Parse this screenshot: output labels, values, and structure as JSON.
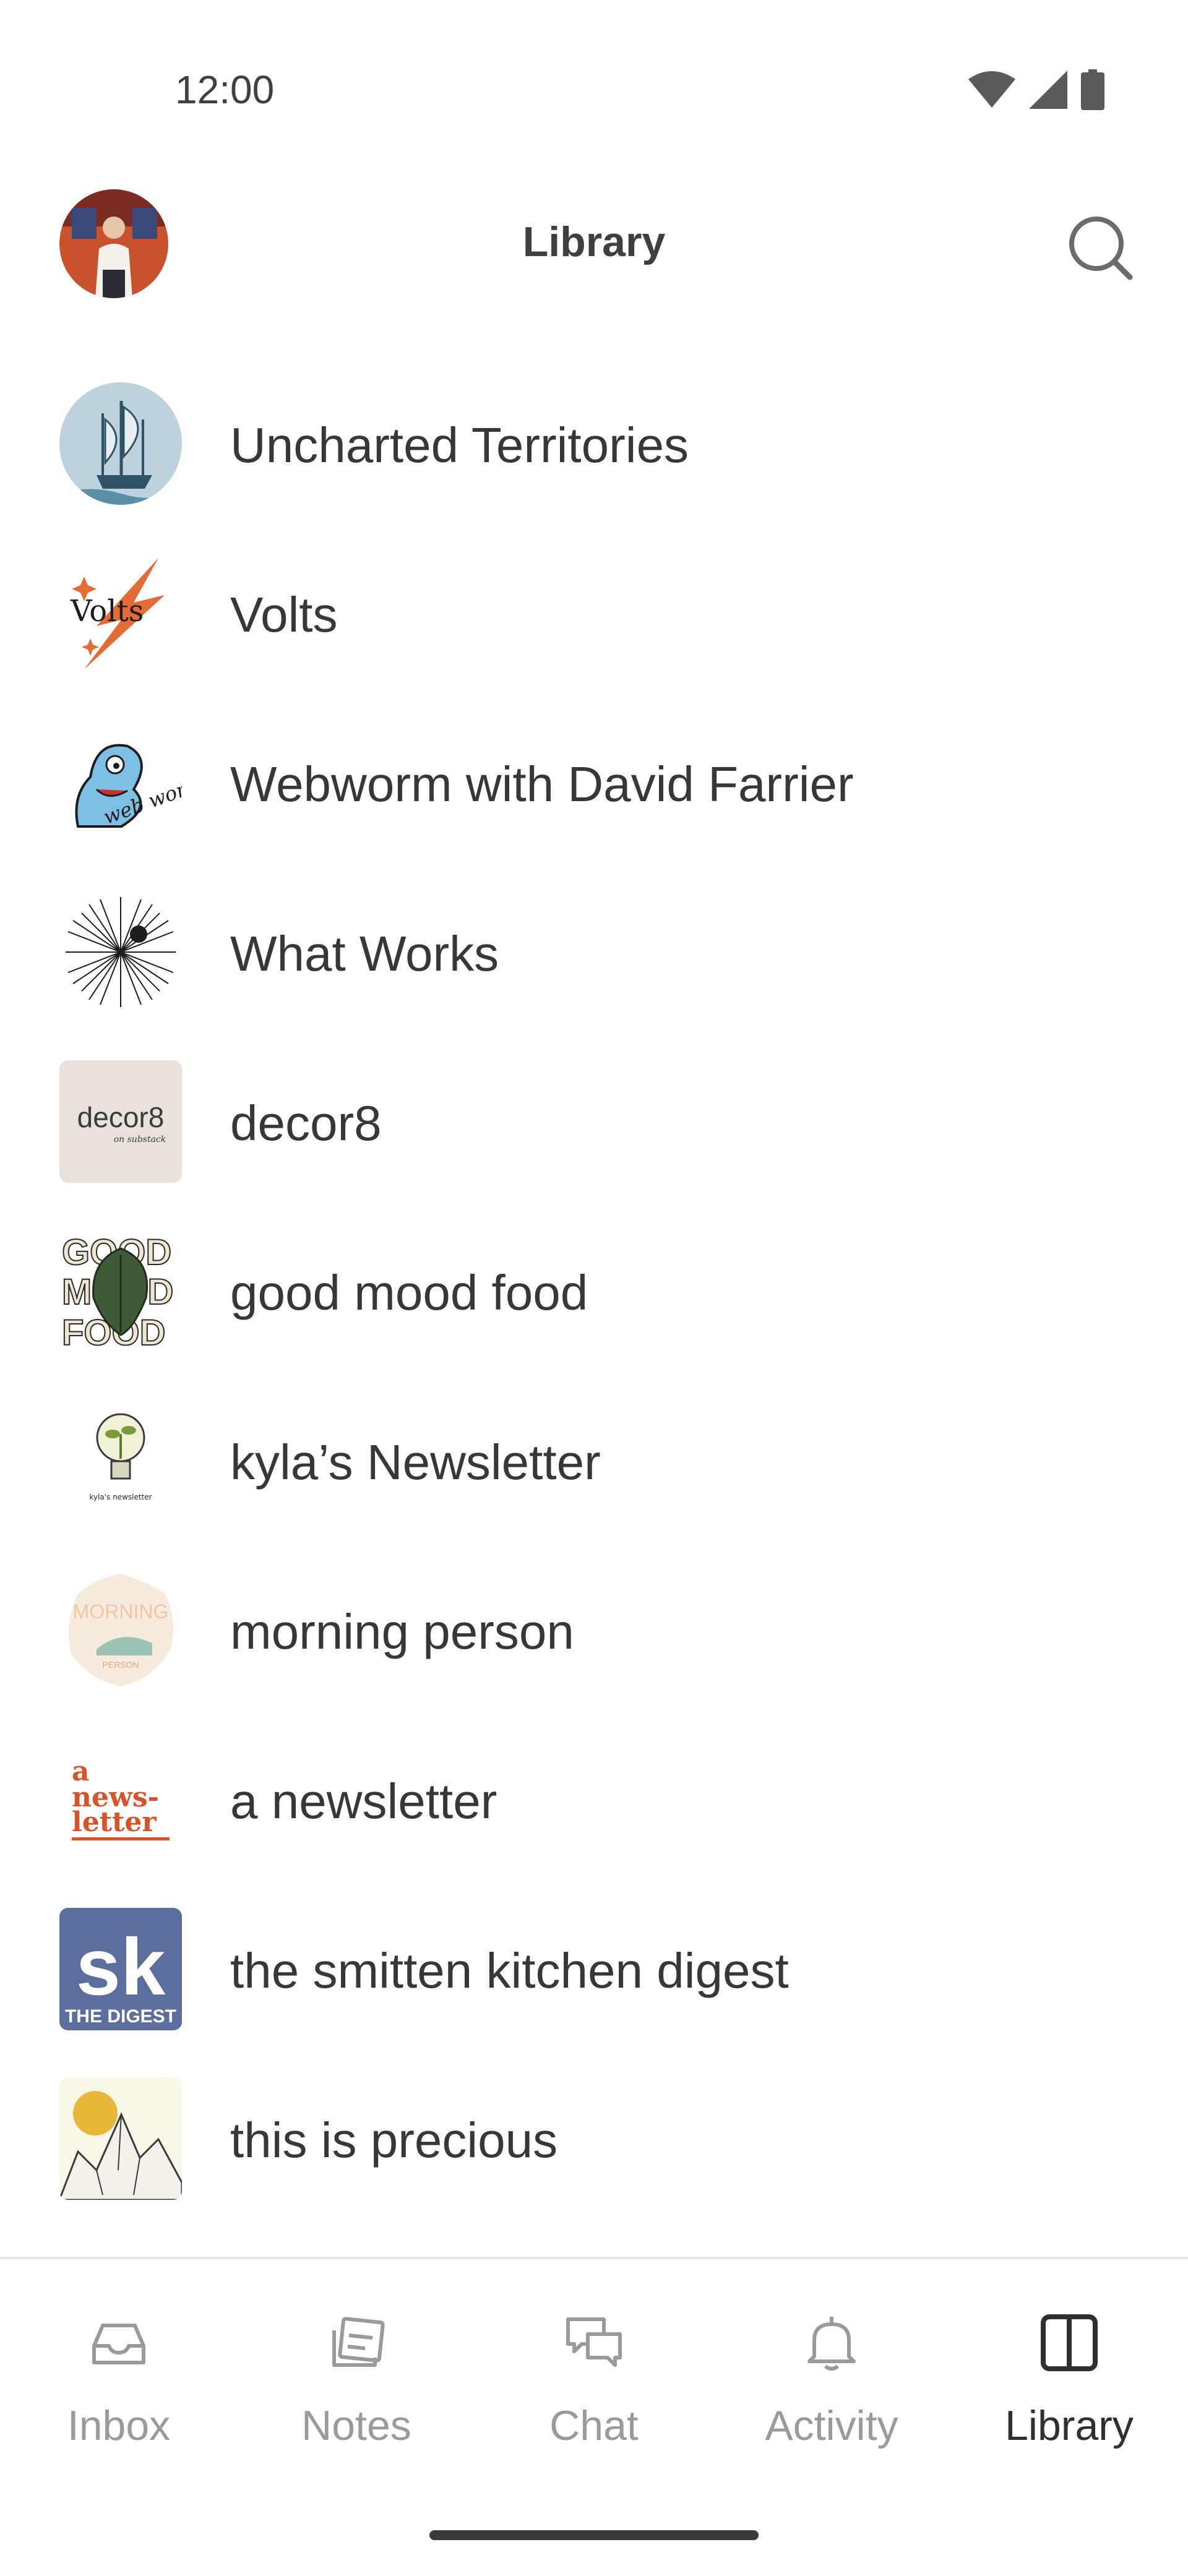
{
  "status_bar": {
    "time": "12:00",
    "icons": [
      "wifi-icon",
      "cellular-signal-icon",
      "battery-icon"
    ]
  },
  "header": {
    "title": "Library",
    "search_icon": "search-icon"
  },
  "publications": [
    {
      "name": "Uncharted Territories",
      "thumb": "ship illustration",
      "color": "#5b8fa8"
    },
    {
      "name": "Volts",
      "thumb": "lightning logo",
      "color": "#e36b35"
    },
    {
      "name": "Webworm with David Farrier",
      "thumb": "blue worm logo",
      "color": "#7cc0e6"
    },
    {
      "name": "What Works",
      "thumb": "starburst",
      "color": "#222222"
    },
    {
      "name": "decor8",
      "thumb": "decor8 wordmark",
      "color": "#e9e2da"
    },
    {
      "name": "good mood food",
      "thumb": "leafy greens",
      "color": "#3f5a36"
    },
    {
      "name": "kyla’s Newsletter",
      "thumb": "lightbulb plant",
      "color": "#7b9a3b"
    },
    {
      "name": "morning person",
      "thumb": "pastel badge",
      "color": "#f4e4d4"
    },
    {
      "name": "a newsletter",
      "thumb": "orange wordmark",
      "color": "#d9532a"
    },
    {
      "name": "the smitten kitchen digest",
      "thumb": "sk digest",
      "color": "#5c6e9e"
    },
    {
      "name": "this is precious",
      "thumb": "sun over rocks",
      "color": "#e8b83a"
    }
  ],
  "thumb_text": {
    "volts": "Volts",
    "webworm": "web worm",
    "decor8": "decor8",
    "decor8_sub": "on substack",
    "gmf_1": "GOOD",
    "gmf_2": "MOOD",
    "gmf_3": "FOOD",
    "kyla": "kyla's newsletter",
    "morning": "MORNING",
    "morning_sub": "PERSON",
    "anews_1": "a",
    "anews_2": "news-",
    "anews_3": "letter",
    "sk": "sk",
    "sk_sub": "THE DIGEST"
  },
  "bottom_nav": [
    {
      "label": "Inbox",
      "icon": "inbox-icon",
      "active": false
    },
    {
      "label": "Notes",
      "icon": "notes-icon",
      "active": false
    },
    {
      "label": "Chat",
      "icon": "chat-icon",
      "active": false
    },
    {
      "label": "Activity",
      "icon": "bell-icon",
      "active": false
    },
    {
      "label": "Library",
      "icon": "library-icon",
      "active": true
    }
  ]
}
